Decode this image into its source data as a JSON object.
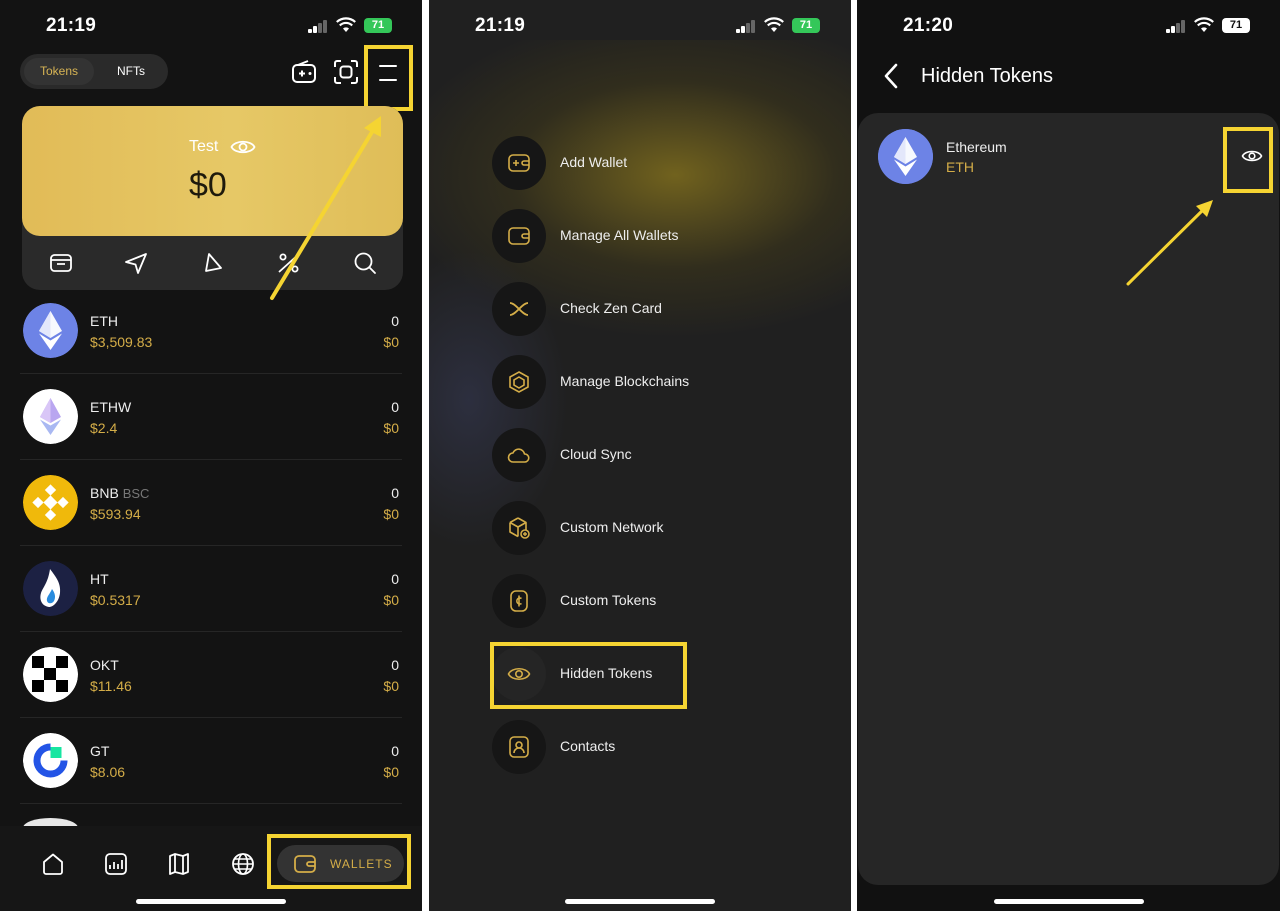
{
  "colors": {
    "accent_gold": "#d4ad48",
    "highlight": "#f5d432",
    "card_gold": "#e3c25f"
  },
  "panel1": {
    "status": {
      "time": "21:19",
      "battery": "71"
    },
    "tabs": {
      "tokens": "Tokens",
      "nfts": "NFTs"
    },
    "wallet_card": {
      "name": "Test",
      "balance": "$0"
    },
    "tokens": [
      {
        "symbol": "ETH",
        "chain": "",
        "price": "$3,509.83",
        "balance": "0",
        "value": "$0",
        "icon": "ethereum-icon"
      },
      {
        "symbol": "ETHW",
        "chain": "",
        "price": "$2.4",
        "balance": "0",
        "value": "$0",
        "icon": "ethw-icon"
      },
      {
        "symbol": "BNB",
        "chain": "BSC",
        "price": "$593.94",
        "balance": "0",
        "value": "$0",
        "icon": "bnb-icon"
      },
      {
        "symbol": "HT",
        "chain": "",
        "price": "$0.5317",
        "balance": "0",
        "value": "$0",
        "icon": "ht-icon"
      },
      {
        "symbol": "OKT",
        "chain": "",
        "price": "$11.46",
        "balance": "0",
        "value": "$0",
        "icon": "okt-icon"
      },
      {
        "symbol": "GT",
        "chain": "",
        "price": "$8.06",
        "balance": "0",
        "value": "$0",
        "icon": "gt-icon"
      }
    ],
    "bottom_nav": {
      "wallets_label": "WALLETS"
    }
  },
  "panel2": {
    "status": {
      "time": "21:19",
      "battery": "71"
    },
    "menu": [
      {
        "label": "Add Wallet",
        "icon": "add-wallet-icon"
      },
      {
        "label": "Manage All Wallets",
        "icon": "wallet-icon"
      },
      {
        "label": "Check Zen Card",
        "icon": "zen-card-icon"
      },
      {
        "label": "Manage Blockchains",
        "icon": "blockchain-icon"
      },
      {
        "label": "Cloud Sync",
        "icon": "cloud-icon"
      },
      {
        "label": "Custom Network",
        "icon": "custom-network-icon"
      },
      {
        "label": "Custom Tokens",
        "icon": "custom-token-icon"
      },
      {
        "label": "Hidden Tokens",
        "icon": "eye-icon"
      },
      {
        "label": "Contacts",
        "icon": "contacts-icon"
      }
    ]
  },
  "panel3": {
    "status": {
      "time": "21:20",
      "battery": "71"
    },
    "title": "Hidden Tokens",
    "token": {
      "name": "Ethereum",
      "symbol": "ETH"
    }
  }
}
